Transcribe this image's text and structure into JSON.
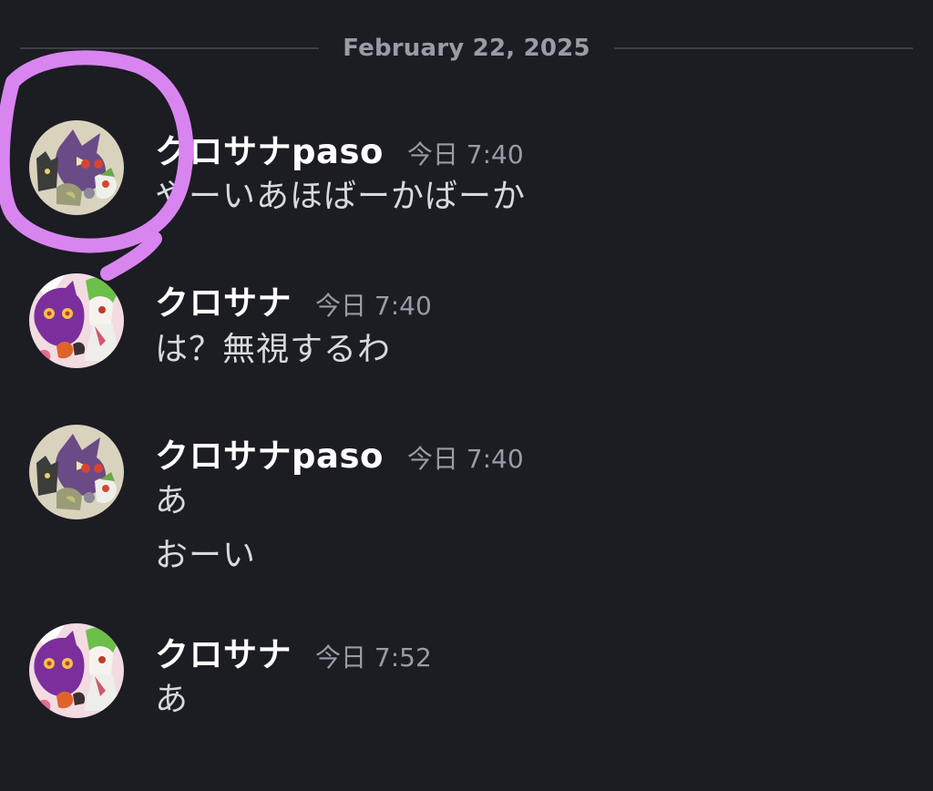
{
  "date_divider": "February 22, 2025",
  "messages": [
    {
      "username": "クロサナpaso",
      "timestamp": "今日 7:40",
      "avatar": "avatar-dark-ghost-art",
      "lines": [
        "やーいあほばーかばーか"
      ]
    },
    {
      "username": "クロサナ",
      "timestamp": "今日 7:40",
      "avatar": "avatar-purple-ghost-art",
      "lines": [
        "は？無視するわ"
      ]
    },
    {
      "username": "クロサナpaso",
      "timestamp": "今日 7:40",
      "avatar": "avatar-dark-ghost-art",
      "lines": [
        "あ",
        "おーい"
      ]
    },
    {
      "username": "クロサナ",
      "timestamp": "今日 7:52",
      "avatar": "avatar-purple-ghost-art",
      "lines": [
        "あ"
      ]
    }
  ],
  "colors": {
    "background": "#1c1c23",
    "username": "#ffffff",
    "timestamp": "#9a9ba5",
    "message_text": "#d8d9dd",
    "annotation_stroke": "#d985f0"
  }
}
